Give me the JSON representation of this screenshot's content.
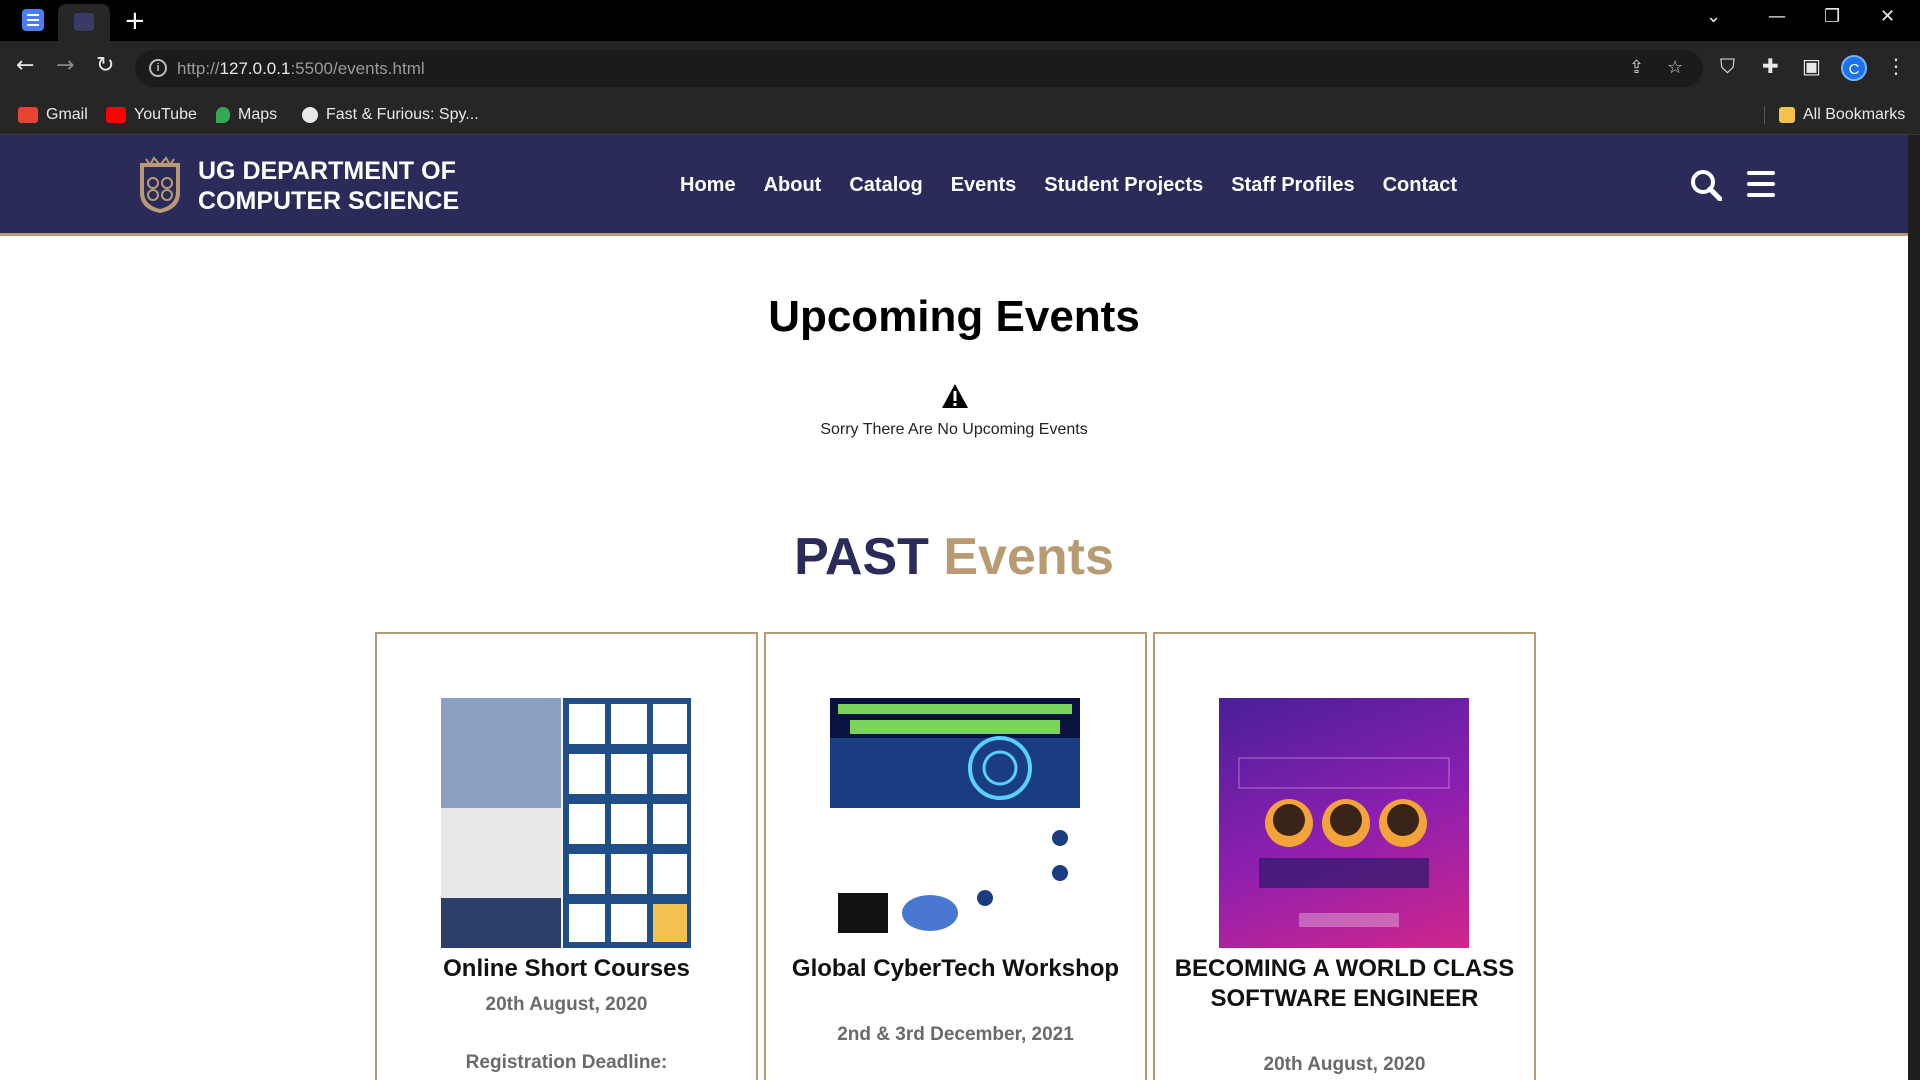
{
  "browser": {
    "url_host": "127.0.0.1",
    "url_rest": ":5500/events.html",
    "url_scheme": "http://",
    "profile_initial": "C",
    "bookmarks": [
      {
        "label": "Gmail",
        "icon": "gmail-icon",
        "color": "#ea4335"
      },
      {
        "label": "YouTube",
        "icon": "youtube-icon",
        "color": "#ff0000"
      },
      {
        "label": "Maps",
        "icon": "maps-icon",
        "color": "#34a853"
      },
      {
        "label": "Fast & Furious: Spy...",
        "icon": "globe-icon",
        "color": "#e8e8e8"
      }
    ],
    "all_bookmarks": "All Bookmarks"
  },
  "site": {
    "title_line1": "UG DEPARTMENT OF",
    "title_line2": "COMPUTER SCIENCE",
    "nav": [
      "Home",
      "About",
      "Catalog",
      "Events",
      "Student Projects",
      "Staff Profiles",
      "Contact"
    ],
    "header_color": "#2b2b5a",
    "accent_color": "#b89b72"
  },
  "upcoming": {
    "title": "Upcoming Events",
    "message": "Sorry There Are No Upcoming Events"
  },
  "past": {
    "title_part1": "PAST",
    "title_part2": "Events",
    "events": [
      {
        "title": "Online Short Courses",
        "date": "20th August, 2020",
        "extra": "Registration Deadline:"
      },
      {
        "title": "Global CyberTech Workshop",
        "date": "2nd & 3rd December, 2021",
        "extra": ""
      },
      {
        "title": "BECOMING A WORLD CLASS SOFTWARE ENGINEER",
        "date": "20th August, 2020",
        "extra": ""
      }
    ]
  }
}
